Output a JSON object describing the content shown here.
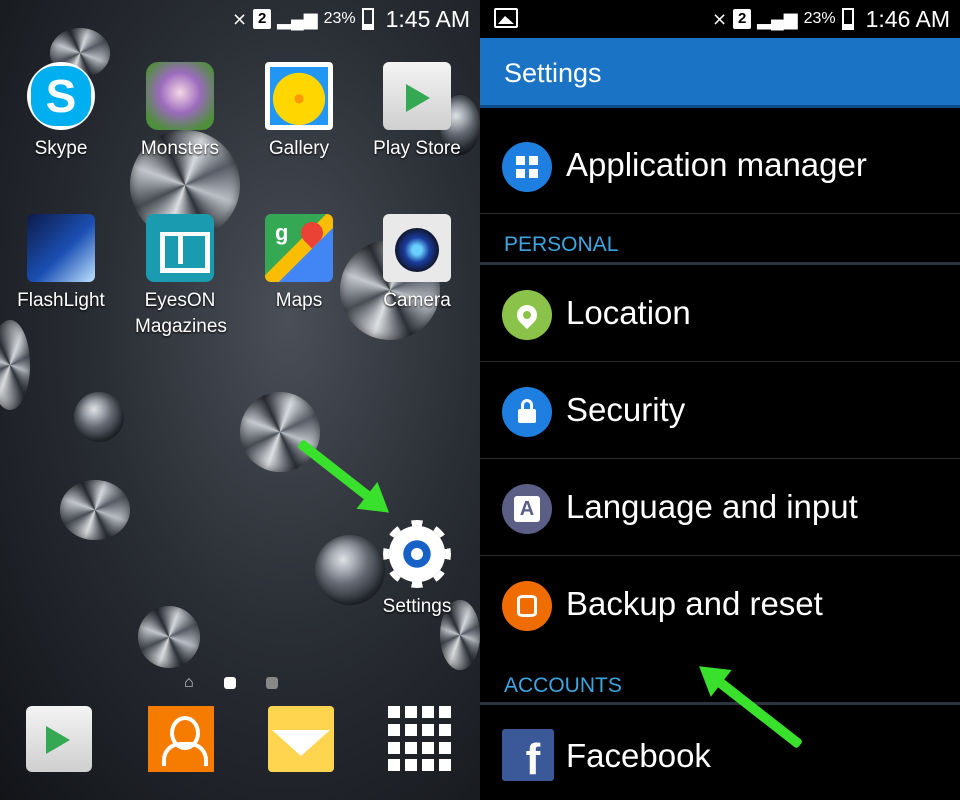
{
  "home": {
    "status": {
      "sim": "2",
      "battery": "23%",
      "time": "1:45 AM"
    },
    "apps": [
      {
        "label": "Skype",
        "icon": "skype-icon"
      },
      {
        "label": "Monsters",
        "icon": "monsters-icon"
      },
      {
        "label": "Gallery",
        "icon": "gallery-icon"
      },
      {
        "label": "Play Store",
        "icon": "play-store-icon"
      },
      {
        "label": "FlashLight",
        "icon": "flashlight-icon"
      },
      {
        "label": "EyesON Magazines",
        "icon": "eyeson-icon"
      },
      {
        "label": "Maps",
        "icon": "maps-icon"
      },
      {
        "label": "Camera",
        "icon": "camera-icon"
      },
      {
        "label": "Settings",
        "icon": "settings-gear-icon"
      }
    ],
    "dock": [
      "play-store-icon",
      "contacts-icon",
      "messages-icon",
      "apps-grid-icon"
    ],
    "maps_letter": "g",
    "skype_letter": "S"
  },
  "settings": {
    "status": {
      "sim": "2",
      "battery": "23%",
      "time": "1:46 AM"
    },
    "title": "Settings",
    "items": [
      {
        "label": "Application manager",
        "icon": "application-manager-icon",
        "color": "#1f7fe0"
      },
      {
        "label": "Location",
        "icon": "location-icon",
        "color": "#8bc34a"
      },
      {
        "label": "Security",
        "icon": "lock-icon",
        "color": "#1f7fe0"
      },
      {
        "label": "Language and input",
        "icon": "language-icon",
        "color": "#5b5f86",
        "glyph": "A"
      },
      {
        "label": "Backup and reset",
        "icon": "backup-icon",
        "color": "#ef6c00"
      },
      {
        "label": "Facebook",
        "icon": "facebook-icon",
        "color": "#3b5998",
        "glyph": "f"
      }
    ],
    "sections": {
      "personal": "PERSONAL",
      "accounts": "ACCOUNTS"
    },
    "accent": "#1a73c4"
  }
}
